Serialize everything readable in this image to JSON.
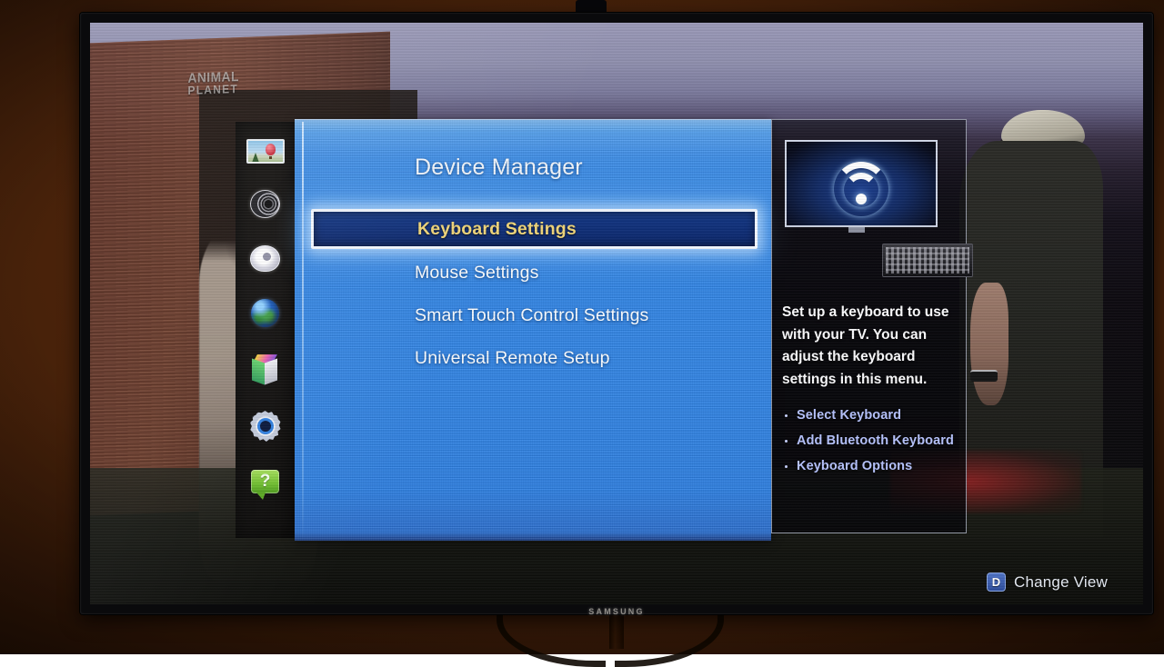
{
  "room": {
    "wall_color": "#46210a"
  },
  "tv": {
    "brand_logo": "SAMSUNG",
    "sensor_icon": "tv-camera-sensor-icon"
  },
  "broadcast": {
    "channel_watermark_line1": "ANIMAL",
    "channel_watermark_line2": "PLANET"
  },
  "menu": {
    "title": "Device Manager",
    "panel_color": "#2f86e8",
    "selected_index": 0,
    "selected_text_color": "#f2d77a",
    "items": [
      {
        "label": "Keyboard Settings",
        "selected": true
      },
      {
        "label": "Mouse Settings",
        "selected": false
      },
      {
        "label": "Smart Touch Control Settings",
        "selected": false
      },
      {
        "label": "Universal Remote Setup",
        "selected": false
      }
    ]
  },
  "rail": {
    "items": [
      {
        "name": "picture",
        "icon": "picture-icon"
      },
      {
        "name": "sound",
        "icon": "speaker-icon"
      },
      {
        "name": "broadcast",
        "icon": "satellite-dish-icon"
      },
      {
        "name": "network",
        "icon": "globe-icon"
      },
      {
        "name": "smart-hub",
        "icon": "cube-icon"
      },
      {
        "name": "system",
        "icon": "gear-icon"
      },
      {
        "name": "support",
        "icon": "help-bubble-icon"
      }
    ]
  },
  "info": {
    "thumbnail_icon": "wifi-icon",
    "device_icon": "keyboard-icon",
    "description": "Set up a keyboard to use with your TV. You can adjust the keyboard settings in this menu.",
    "bullets": [
      "Select Keyboard",
      "Add Bluetooth Keyboard",
      "Keyboard Options"
    ],
    "bullet_color": "#b7c4ff"
  },
  "footer": {
    "key": "D",
    "label": "Change View",
    "key_color": "#2c4c9c"
  }
}
